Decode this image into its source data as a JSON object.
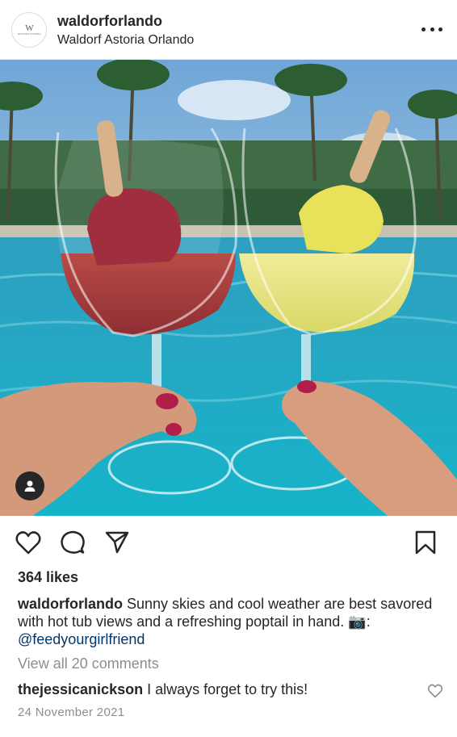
{
  "header": {
    "username": "waldorforlando",
    "location": "Waldorf Astoria Orlando",
    "avatar_logo": "W",
    "avatar_logo_text": "WALDORF ASTORIA"
  },
  "post": {
    "image_description_icon": "tagged-user-icon",
    "likes": "364 likes",
    "caption": {
      "username": "waldorforlando",
      "text": " Sunny skies and cool weather are best savored with hot tub views and a refreshing poptail in hand. ",
      "camera_emoji": "📷",
      "colon": ": ",
      "mention": "@feedyourgirlfriend"
    },
    "view_comments": "View all 20 comments",
    "comment": {
      "username": "thejessicanickson",
      "text": " I always forget to try this!"
    },
    "date": "24 November 2021"
  },
  "icons": {
    "like": "heart-icon",
    "comment": "comment-icon",
    "share": "share-icon",
    "save": "bookmark-icon",
    "more": "more-icon"
  },
  "colors": {
    "text": "#262626",
    "muted": "#8e8e8e",
    "link": "#00376b"
  }
}
